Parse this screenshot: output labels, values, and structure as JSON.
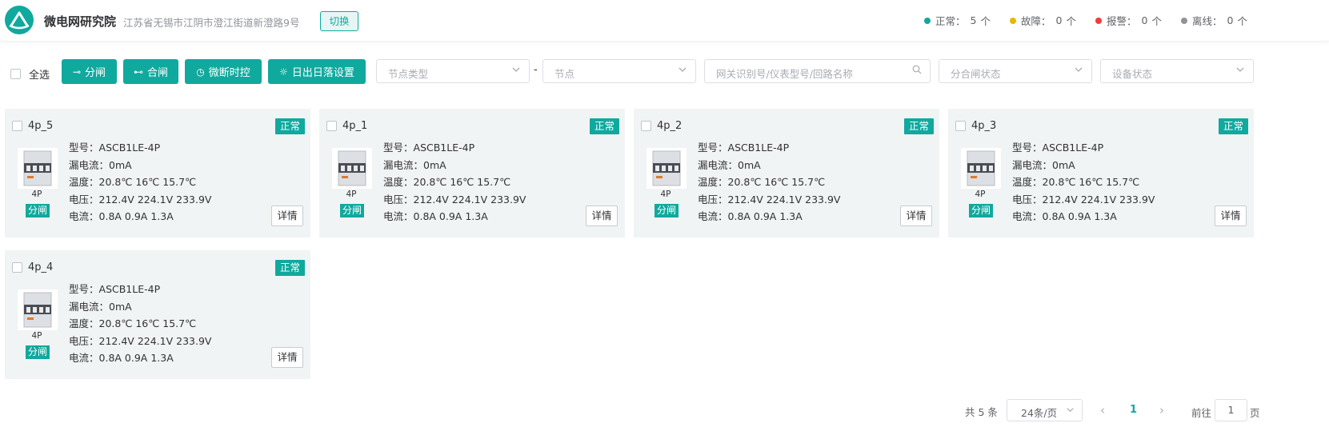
{
  "header": {
    "site_name": "微电网研究院",
    "address": "江苏省无锡市江阴市澄江街道新澄路9号",
    "switch_label": "切换",
    "status": [
      {
        "label": "正常：",
        "count": "5",
        "unit": "个",
        "color": "#10a99e"
      },
      {
        "label": "故障：",
        "count": "0",
        "unit": "个",
        "color": "#e6b800"
      },
      {
        "label": "报警：",
        "count": "0",
        "unit": "个",
        "color": "#f03c3c"
      },
      {
        "label": "离线：",
        "count": "0",
        "unit": "个",
        "color": "#909399"
      }
    ]
  },
  "toolbar": {
    "select_all_label": "全选",
    "open_label": "分闸",
    "close_label": "合闸",
    "micro_timer_label": "微断时控",
    "sun_label": "日出日落设置",
    "node_type_placeholder": "节点类型",
    "separator": "-",
    "node_placeholder": "节点",
    "search_placeholder": "网关识别号/仪表型号/回路名称",
    "switch_state_placeholder": "分合闸状态",
    "device_state_placeholder": "设备状态"
  },
  "labels": {
    "model_prefix": "型号：",
    "leak_prefix": "漏电流：",
    "temp_prefix": "温度：",
    "voltage_prefix": "电压：",
    "current_prefix": "电流：",
    "detail_button": "详情"
  },
  "cards": [
    {
      "name": "4p_5",
      "status": "正常",
      "caption": "4P",
      "gate": "分闸",
      "model": "ASCB1LE-4P",
      "leak": "0mA",
      "temp": "20.8℃ 16℃ 15.7℃",
      "voltage": "212.4V 224.1V 233.9V",
      "current": "0.8A 0.9A 1.3A"
    },
    {
      "name": "4p_1",
      "status": "正常",
      "caption": "4P",
      "gate": "分闸",
      "model": "ASCB1LE-4P",
      "leak": "0mA",
      "temp": "20.8℃ 16℃ 15.7℃",
      "voltage": "212.4V 224.1V 233.9V",
      "current": "0.8A 0.9A 1.3A"
    },
    {
      "name": "4p_2",
      "status": "正常",
      "caption": "4P",
      "gate": "分闸",
      "model": "ASCB1LE-4P",
      "leak": "0mA",
      "temp": "20.8℃ 16℃ 15.7℃",
      "voltage": "212.4V 224.1V 233.9V",
      "current": "0.8A 0.9A 1.3A"
    },
    {
      "name": "4p_3",
      "status": "正常",
      "caption": "4P",
      "gate": "分闸",
      "model": "ASCB1LE-4P",
      "leak": "0mA",
      "temp": "20.8℃ 16℃ 15.7℃",
      "voltage": "212.4V 224.1V 233.9V",
      "current": "0.8A 0.9A 1.3A"
    },
    {
      "name": "4p_4",
      "status": "正常",
      "caption": "4P",
      "gate": "分闸",
      "model": "ASCB1LE-4P",
      "leak": "0mA",
      "temp": "20.8℃ 16℃ 15.7℃",
      "voltage": "212.4V 224.1V 233.9V",
      "current": "0.8A 0.9A 1.3A"
    }
  ],
  "pagination": {
    "total": "共 5 条",
    "page_size": "24条/页",
    "prev": "‹",
    "current_page": "1",
    "next": "›",
    "goto_label": "前往",
    "goto_value": "1",
    "goto_tail": "页"
  }
}
